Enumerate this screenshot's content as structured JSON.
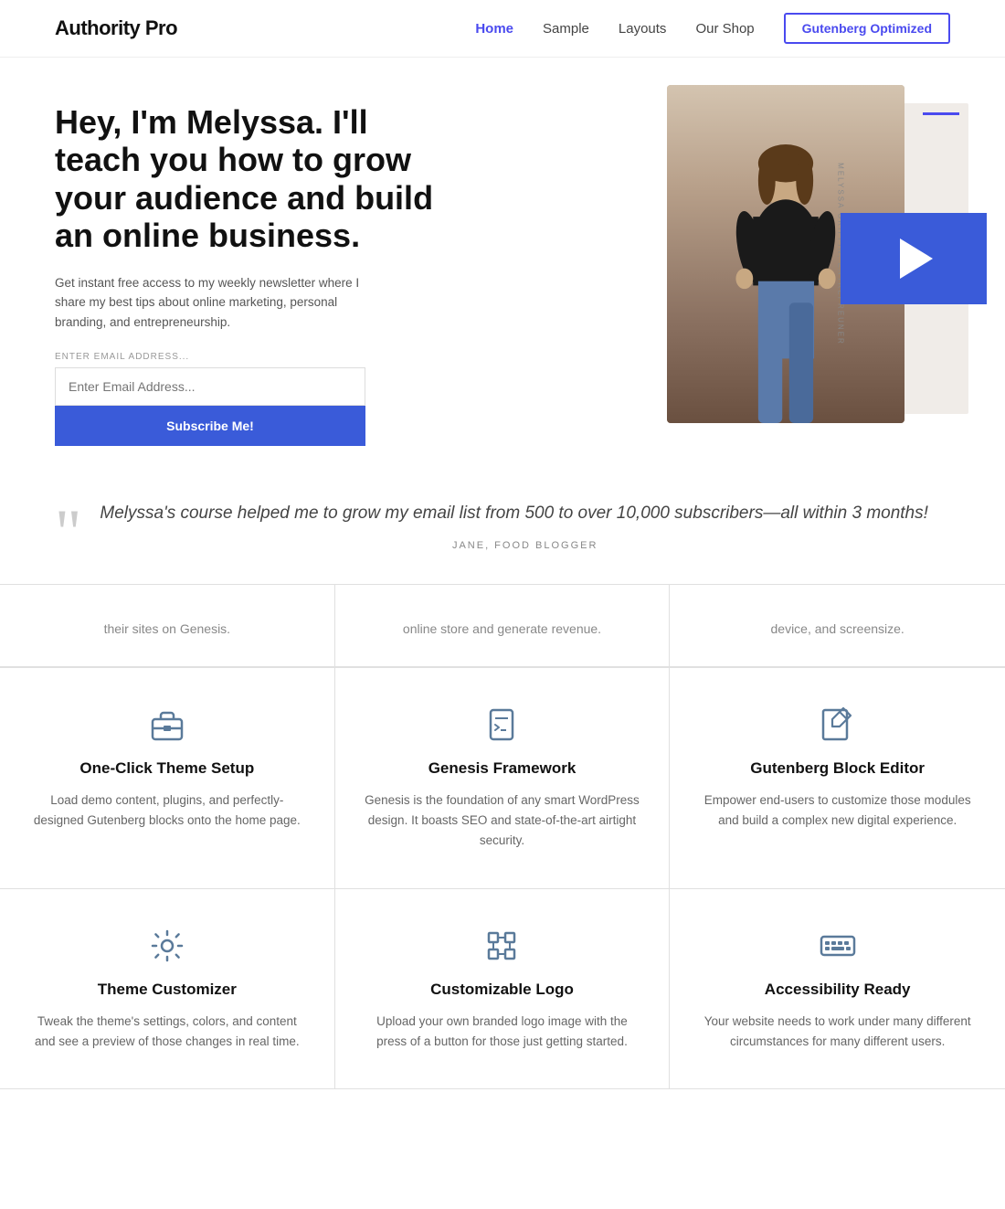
{
  "header": {
    "logo": "Authority Pro",
    "nav": [
      {
        "label": "Home",
        "active": true
      },
      {
        "label": "Sample",
        "active": false
      },
      {
        "label": "Layouts",
        "active": false
      },
      {
        "label": "Our Shop",
        "active": false
      }
    ],
    "cta_button": "Gutenberg Optimized"
  },
  "hero": {
    "title": "Hey, I'm Melyssa. I'll teach you how to grow your audience and build an online business.",
    "description": "Get instant free access to my weekly newsletter where I share my best tips about online marketing, personal branding, and entrepreneurship.",
    "form": {
      "label": "Enter Email Address...",
      "placeholder": "Enter Email Address...",
      "submit": "Subscribe Me!"
    },
    "photo_label": "Melyssa Griffin, Entrepreuner"
  },
  "testimonial": {
    "quote": "Melyssa's course helped me to grow my email list from 500 to over 10,000 subscribers—all within 3 months!",
    "author": "Jane, Food Blogger"
  },
  "features_top": [
    {
      "text": "their sites on Genesis."
    },
    {
      "text": "online store and generate revenue."
    },
    {
      "text": "device, and screensize."
    }
  ],
  "features": [
    {
      "icon": "briefcase",
      "title": "One-Click Theme Setup",
      "description": "Load demo content, plugins, and perfectly-designed Gutenberg blocks onto the home page."
    },
    {
      "icon": "code",
      "title": "Genesis Framework",
      "description": "Genesis is the foundation of any smart WordPress design. It boasts SEO and state-of-the-art airtight security."
    },
    {
      "icon": "edit",
      "title": "Gutenberg Block Editor",
      "description": "Empower end-users to customize those modules and build a complex new digital experience."
    },
    {
      "icon": "settings",
      "title": "Theme Customizer",
      "description": "Tweak the theme's settings, colors, and content and see a preview of those changes in real time."
    },
    {
      "icon": "frame",
      "title": "Customizable Logo",
      "description": "Upload your own branded logo image with the press of a button for those just getting started."
    },
    {
      "icon": "keyboard",
      "title": "Accessibility Ready",
      "description": "Your website needs to work under many different circumstances for many different users."
    }
  ]
}
